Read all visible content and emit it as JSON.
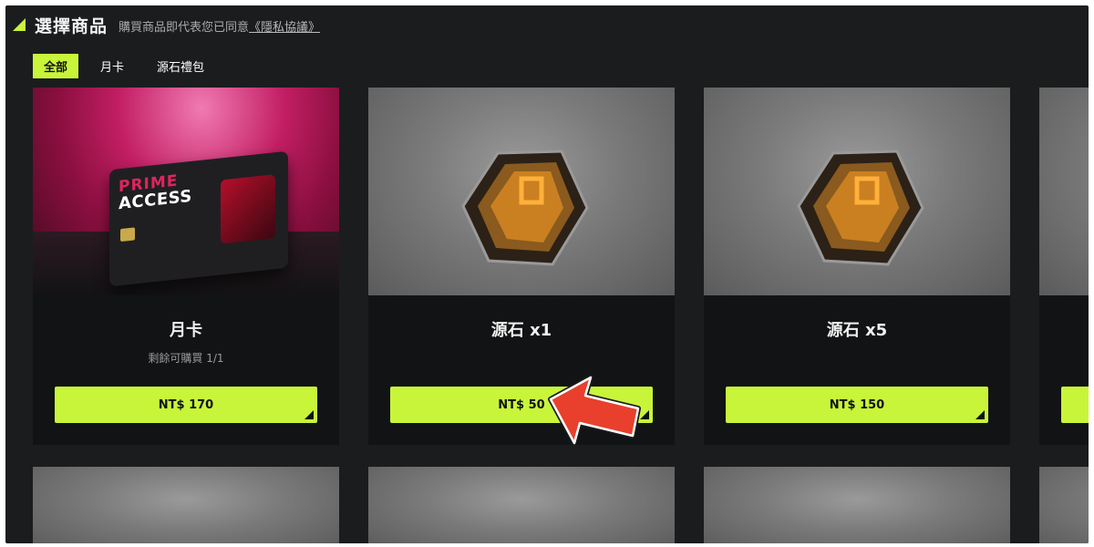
{
  "header": {
    "title": "選擇商品",
    "subtitle": "購買商品即代表您已同意",
    "privacy_link": "《隱私協議》"
  },
  "tabs": [
    {
      "label": "全部",
      "active": true
    },
    {
      "label": "月卡",
      "active": false
    },
    {
      "label": "源石禮包",
      "active": false
    }
  ],
  "products": [
    {
      "title": "月卡",
      "subtitle": "剩餘可購買 1/1",
      "price": "NT$ 170",
      "image": "prime-access-card"
    },
    {
      "title": "源石 x1",
      "subtitle": "",
      "price": "NT$ 50",
      "image": "originium-gem"
    },
    {
      "title": "源石 x5",
      "subtitle": "",
      "price": "NT$ 150",
      "image": "originium-gem"
    }
  ],
  "prime_card": {
    "line1": "PRIME",
    "line2": "ACCESS"
  },
  "colors": {
    "accent": "#c8f53a",
    "background": "#1b1c1e",
    "card": "#121314",
    "annotation_arrow": "#e8402c"
  }
}
